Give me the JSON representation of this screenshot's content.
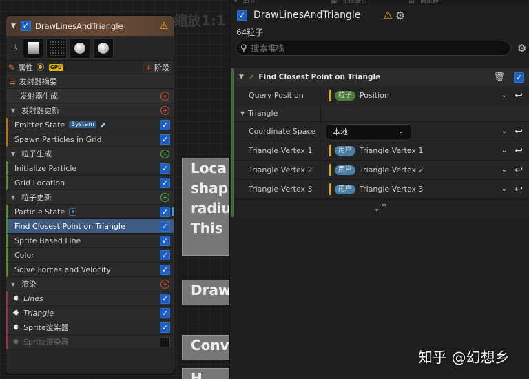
{
  "graph": {
    "zoom_label": "缩放1:1",
    "nodes": [
      {
        "text": "Loca\nshap\nradiu\nThis"
      },
      {
        "text": "Draw"
      },
      {
        "text": "Conv"
      },
      {
        "text": "H"
      }
    ]
  },
  "emitter_node": {
    "title": "DrawLinesAndTriangle",
    "header_color": "#6b4a35",
    "properties_label": "属性",
    "gpu_badge": "GPU",
    "stage_button": "阶段",
    "rows": [
      {
        "label": "发射器摘要"
      },
      {
        "label": "发射器生成"
      },
      {
        "label": "发射器更新"
      },
      {
        "label": "Emitter State",
        "badge": "System"
      },
      {
        "label": "Spawn Particles in Grid"
      },
      {
        "label": "粒子生成"
      },
      {
        "label": "Initialize Particle"
      },
      {
        "label": "Grid Location"
      },
      {
        "label": "粒子更新"
      },
      {
        "label": "Particle State"
      },
      {
        "label": "Find Closest Point on Triangle"
      },
      {
        "label": "Sprite Based Line"
      },
      {
        "label": "Color"
      },
      {
        "label": "Solve Forces and Velocity"
      },
      {
        "label": "渲染"
      },
      {
        "label": "Lines"
      },
      {
        "label": "Triangle"
      },
      {
        "label": "Sprite渲染器"
      },
      {
        "label": "Sprite渲染器"
      }
    ]
  },
  "panel": {
    "top_tabs": [
      "▾",
      "细节",
      "▦",
      "生成报告",
      "▤",
      "调试器"
    ],
    "title": "DrawLinesAndTriangle",
    "particle_count": "64粒子",
    "search_placeholder": "搜索堆栈",
    "module": {
      "title": "Find Closest Point on Triangle",
      "accent_color": "#3f6e3a",
      "rows": [
        {
          "name": "Query Position",
          "tag": "粒子",
          "value": "Position"
        },
        {
          "name": "Triangle"
        },
        {
          "name": "Coordinate Space",
          "value": "本地"
        },
        {
          "name": "Triangle Vertex 1",
          "tag": "用户",
          "value": "Triangle Vertex 1"
        },
        {
          "name": "Triangle Vertex 2",
          "tag": "用户",
          "value": "Triangle Vertex 2"
        },
        {
          "name": "Triangle Vertex 3",
          "tag": "用户",
          "value": "Triangle Vertex 3"
        }
      ],
      "footer_star": "*"
    }
  },
  "watermark": "知乎 @幻想乡"
}
